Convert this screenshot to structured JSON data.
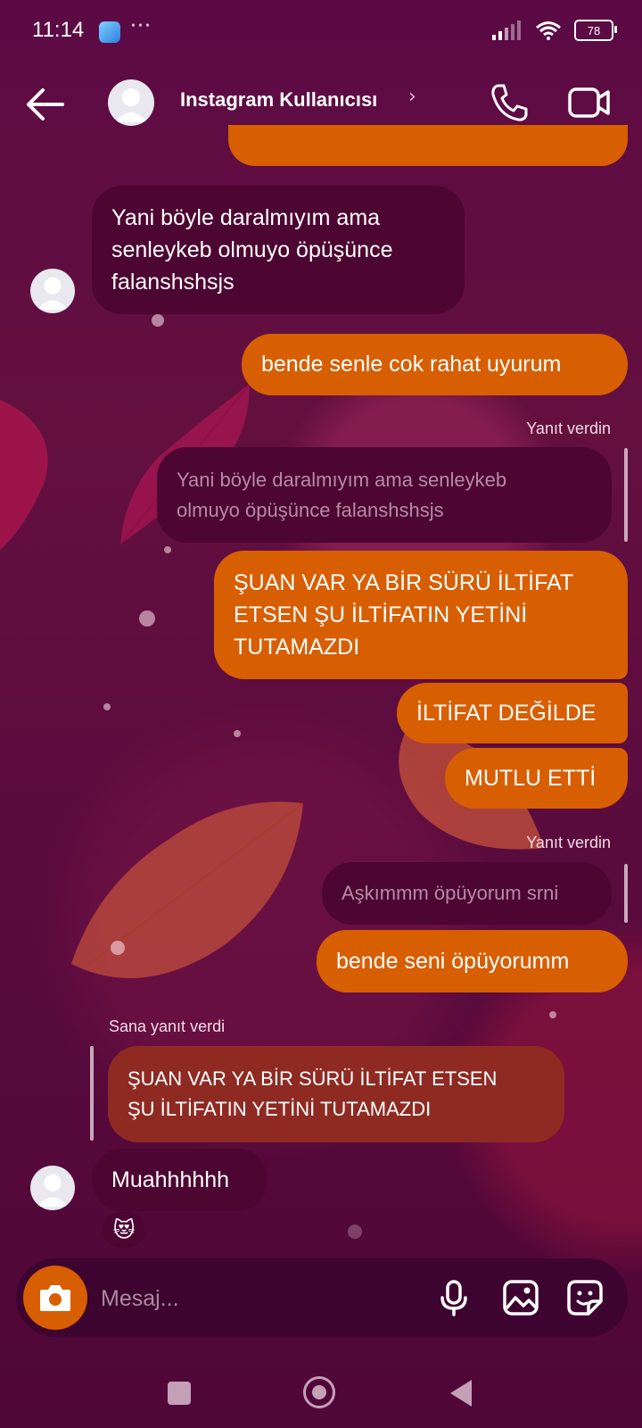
{
  "status_bar": {
    "time": "11:14",
    "dots": "···",
    "battery": "78"
  },
  "header": {
    "contact_name": "Instagram Kullanıcısı",
    "chevron": "›"
  },
  "messages": {
    "m1": [
      "Yani böyle daralmıyım ama",
      "senleykeb olmuyo öpüşünce",
      "falanshshsjs"
    ],
    "m2": "bende senle cok rahat uyurum",
    "reply_label_1": "Yanıt verdin",
    "quote_1": [
      "Yani böyle daralmıyım ama senleykeb",
      "olmuyo öpüşünce falanshshsjs"
    ],
    "m3": [
      "ŞUAN VAR YA BİR SÜRÜ İLTİFAT",
      "ETSEN ŞU İLTİFATIN YETİNİ",
      "TUTAMAZDI"
    ],
    "m4": "İLTİFAT DEĞİLDE",
    "m5": "MUTLU ETTİ",
    "reply_label_2": "Yanıt verdin",
    "quote_2": "Aşkımmm öpüyorum srni",
    "m6": "bende seni öpüyorumm",
    "reply_label_3": "Sana yanıt verdi",
    "quote_3": [
      "ŞUAN VAR YA BİR SÜRÜ İLTİFAT ETSEN",
      "ŞU İLTİFATIN YETİNİ TUTAMAZDI"
    ],
    "m7": "Muahhhhhh",
    "reaction": "😻"
  },
  "composer": {
    "placeholder": "Mesaj..."
  },
  "icons": {
    "back": "arrow-left-icon",
    "call": "phone-icon",
    "video": "video-camera-icon",
    "camera": "camera-icon",
    "mic": "microphone-icon",
    "gallery": "image-icon",
    "sticker": "sticker-icon"
  },
  "colors": {
    "outgoing": "#d85e02",
    "incoming": "#4d0532",
    "quoted_reply": "#8f2a22",
    "background": "#5c0a44"
  }
}
